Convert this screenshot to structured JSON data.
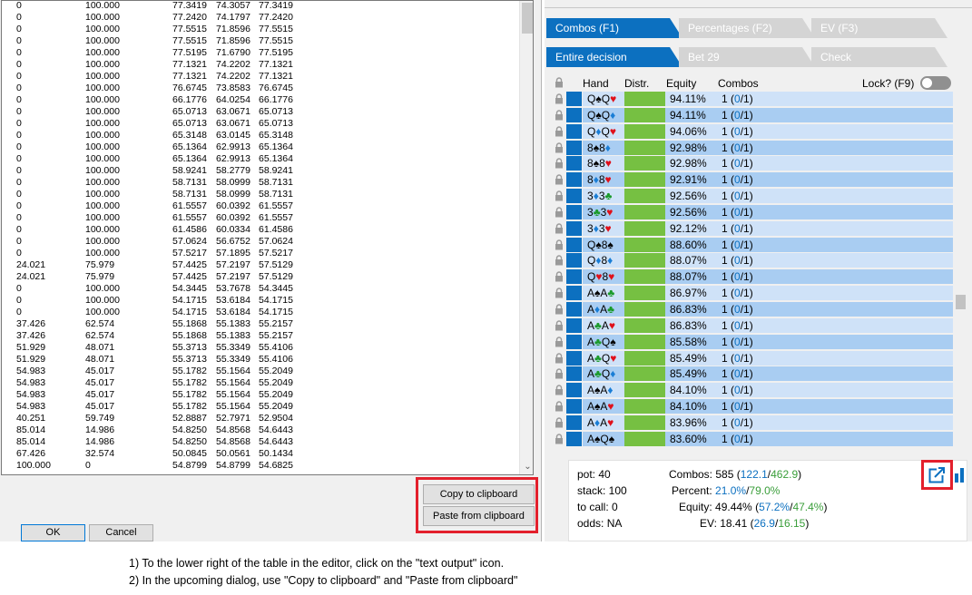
{
  "left_dialog": {
    "text_lines": [
      [
        "0",
        "100.000",
        "77.3419",
        "74.3057",
        "77.3419"
      ],
      [
        "0",
        "100.000",
        "77.2420",
        "74.1797",
        "77.2420"
      ],
      [
        "0",
        "100.000",
        "77.5515",
        "71.8596",
        "77.5515"
      ],
      [
        "0",
        "100.000",
        "77.5515",
        "71.8596",
        "77.5515"
      ],
      [
        "0",
        "100.000",
        "77.5195",
        "71.6790",
        "77.5195"
      ],
      [
        "0",
        "100.000",
        "77.1321",
        "74.2202",
        "77.1321"
      ],
      [
        "0",
        "100.000",
        "77.1321",
        "74.2202",
        "77.1321"
      ],
      [
        "0",
        "100.000",
        "76.6745",
        "73.8583",
        "76.6745"
      ],
      [
        "0",
        "100.000",
        "66.1776",
        "64.0254",
        "66.1776"
      ],
      [
        "0",
        "100.000",
        "65.0713",
        "63.0671",
        "65.0713"
      ],
      [
        "0",
        "100.000",
        "65.0713",
        "63.0671",
        "65.0713"
      ],
      [
        "0",
        "100.000",
        "65.3148",
        "63.0145",
        "65.3148"
      ],
      [
        "0",
        "100.000",
        "65.1364",
        "62.9913",
        "65.1364"
      ],
      [
        "0",
        "100.000",
        "65.1364",
        "62.9913",
        "65.1364"
      ],
      [
        "0",
        "100.000",
        "58.9241",
        "58.2779",
        "58.9241"
      ],
      [
        "0",
        "100.000",
        "58.7131",
        "58.0999",
        "58.7131"
      ],
      [
        "0",
        "100.000",
        "58.7131",
        "58.0999",
        "58.7131"
      ],
      [
        "0",
        "100.000",
        "61.5557",
        "60.0392",
        "61.5557"
      ],
      [
        "0",
        "100.000",
        "61.5557",
        "60.0392",
        "61.5557"
      ],
      [
        "0",
        "100.000",
        "61.4586",
        "60.0334",
        "61.4586"
      ],
      [
        "0",
        "100.000",
        "57.0624",
        "56.6752",
        "57.0624"
      ],
      [
        "0",
        "100.000",
        "57.5217",
        "57.1895",
        "57.5217"
      ],
      [
        "24.021",
        "75.979",
        "57.4425",
        "57.2197",
        "57.5129"
      ],
      [
        "24.021",
        "75.979",
        "57.4425",
        "57.2197",
        "57.5129"
      ],
      [
        "0",
        "100.000",
        "54.3445",
        "53.7678",
        "54.3445"
      ],
      [
        "0",
        "100.000",
        "54.1715",
        "53.6184",
        "54.1715"
      ],
      [
        "0",
        "100.000",
        "54.1715",
        "53.6184",
        "54.1715"
      ],
      [
        "37.426",
        "62.574",
        "55.1868",
        "55.1383",
        "55.2157"
      ],
      [
        "37.426",
        "62.574",
        "55.1868",
        "55.1383",
        "55.2157"
      ],
      [
        "51.929",
        "48.071",
        "55.3713",
        "55.3349",
        "55.4106"
      ],
      [
        "51.929",
        "48.071",
        "55.3713",
        "55.3349",
        "55.4106"
      ],
      [
        "54.983",
        "45.017",
        "55.1782",
        "55.1564",
        "55.2049"
      ],
      [
        "54.983",
        "45.017",
        "55.1782",
        "55.1564",
        "55.2049"
      ],
      [
        "54.983",
        "45.017",
        "55.1782",
        "55.1564",
        "55.2049"
      ],
      [
        "54.983",
        "45.017",
        "55.1782",
        "55.1564",
        "55.2049"
      ],
      [
        "40.251",
        "59.749",
        "52.8887",
        "52.7971",
        "52.9504"
      ],
      [
        "85.014",
        "14.986",
        "54.8250",
        "54.8568",
        "54.6443"
      ],
      [
        "85.014",
        "14.986",
        "54.8250",
        "54.8568",
        "54.6443"
      ],
      [
        "67.426",
        "32.574",
        "50.0845",
        "50.0561",
        "50.1434"
      ],
      [
        "100.000",
        "0",
        "54.8799",
        "54.8799",
        "54.6825"
      ]
    ],
    "copy_label": "Copy to clipboard",
    "paste_label": "Paste from clipboard",
    "ok_label": "OK",
    "cancel_label": "Cancel"
  },
  "right_panel": {
    "tabs_row1": [
      "Combos (F1)",
      "Percentages (F2)",
      "EV (F3)"
    ],
    "tabs_row2": [
      "Entire decision",
      "Bet 29",
      "Check"
    ],
    "headers": {
      "hand": "Hand",
      "distr": "Distr.",
      "equity": "Equity",
      "combos": "Combos",
      "lock": "Lock? (F9)"
    },
    "rows": [
      {
        "r1": "Q",
        "s1": "♠",
        "r2": "Q",
        "s2": "♥",
        "equity": "94.11%",
        "combos": "1 (0/1)"
      },
      {
        "r1": "Q",
        "s1": "♠",
        "r2": "Q",
        "s2": "♦",
        "equity": "94.11%",
        "combos": "1 (0/1)"
      },
      {
        "r1": "Q",
        "s1": "♦",
        "r2": "Q",
        "s2": "♥",
        "equity": "94.06%",
        "combos": "1 (0/1)"
      },
      {
        "r1": "8",
        "s1": "♠",
        "r2": "8",
        "s2": "♦",
        "equity": "92.98%",
        "combos": "1 (0/1)"
      },
      {
        "r1": "8",
        "s1": "♠",
        "r2": "8",
        "s2": "♥",
        "equity": "92.98%",
        "combos": "1 (0/1)"
      },
      {
        "r1": "8",
        "s1": "♦",
        "r2": "8",
        "s2": "♥",
        "equity": "92.91%",
        "combos": "1 (0/1)"
      },
      {
        "r1": "3",
        "s1": "♦",
        "r2": "3",
        "s2": "♣",
        "equity": "92.56%",
        "combos": "1 (0/1)"
      },
      {
        "r1": "3",
        "s1": "♣",
        "r2": "3",
        "s2": "♥",
        "equity": "92.56%",
        "combos": "1 (0/1)"
      },
      {
        "r1": "3",
        "s1": "♦",
        "r2": "3",
        "s2": "♥",
        "equity": "92.12%",
        "combos": "1 (0/1)"
      },
      {
        "r1": "Q",
        "s1": "♠",
        "r2": "8",
        "s2": "♠",
        "equity": "88.60%",
        "combos": "1 (0/1)"
      },
      {
        "r1": "Q",
        "s1": "♦",
        "r2": "8",
        "s2": "♦",
        "equity": "88.07%",
        "combos": "1 (0/1)"
      },
      {
        "r1": "Q",
        "s1": "♥",
        "r2": "8",
        "s2": "♥",
        "equity": "88.07%",
        "combos": "1 (0/1)"
      },
      {
        "r1": "A",
        "s1": "♠",
        "r2": "A",
        "s2": "♣",
        "equity": "86.97%",
        "combos": "1 (0/1)"
      },
      {
        "r1": "A",
        "s1": "♦",
        "r2": "A",
        "s2": "♣",
        "equity": "86.83%",
        "combos": "1 (0/1)"
      },
      {
        "r1": "A",
        "s1": "♣",
        "r2": "A",
        "s2": "♥",
        "equity": "86.83%",
        "combos": "1 (0/1)"
      },
      {
        "r1": "A",
        "s1": "♣",
        "r2": "Q",
        "s2": "♠",
        "equity": "85.58%",
        "combos": "1 (0/1)"
      },
      {
        "r1": "A",
        "s1": "♣",
        "r2": "Q",
        "s2": "♥",
        "equity": "85.49%",
        "combos": "1 (0/1)"
      },
      {
        "r1": "A",
        "s1": "♣",
        "r2": "Q",
        "s2": "♦",
        "equity": "85.49%",
        "combos": "1 (0/1)"
      },
      {
        "r1": "A",
        "s1": "♠",
        "r2": "A",
        "s2": "♦",
        "equity": "84.10%",
        "combos": "1 (0/1)"
      },
      {
        "r1": "A",
        "s1": "♠",
        "r2": "A",
        "s2": "♥",
        "equity": "84.10%",
        "combos": "1 (0/1)"
      },
      {
        "r1": "A",
        "s1": "♦",
        "r2": "A",
        "s2": "♥",
        "equity": "83.96%",
        "combos": "1 (0/1)"
      },
      {
        "r1": "A",
        "s1": "♠",
        "r2": "Q",
        "s2": "♠",
        "equity": "83.60%",
        "combos": "1 (0/1)"
      }
    ],
    "stats": {
      "pot": "pot: 40",
      "stack": "stack: 100",
      "tocall": "to call: 0",
      "odds": "odds: NA",
      "combos_label": "Combos:",
      "combos_main": "585 (",
      "combos_a": "122.1",
      "combos_sep": "/",
      "combos_b": "462.9",
      "combos_end": ")",
      "percent_label": "Percent:",
      "percent_a": "21.0%",
      "percent_sep": "/",
      "percent_b": "79.0%",
      "equity_label": "Equity:",
      "equity_main": "49.44% (",
      "equity_a": "57.2%",
      "equity_sep": "/",
      "equity_b": "47.4%",
      "equity_end": ")",
      "ev_label": "EV:",
      "ev_main": "18.41 (",
      "ev_a": "26.9",
      "ev_sep": "/",
      "ev_b": "16.15",
      "ev_end": ")"
    },
    "colors": {
      "accent": "#0c70c0",
      "green": "#3a9e3a",
      "heart": "#e0101a",
      "diamond": "#1a7ed6",
      "club": "#1a9a2a",
      "spade": "#000000"
    }
  },
  "instructions": [
    "1) To the lower right of the table in the editor, click on the \"text output\" icon.",
    "2) In the upcoming dialog, use \"Copy to clipboard\" and \"Paste from clipboard\""
  ]
}
